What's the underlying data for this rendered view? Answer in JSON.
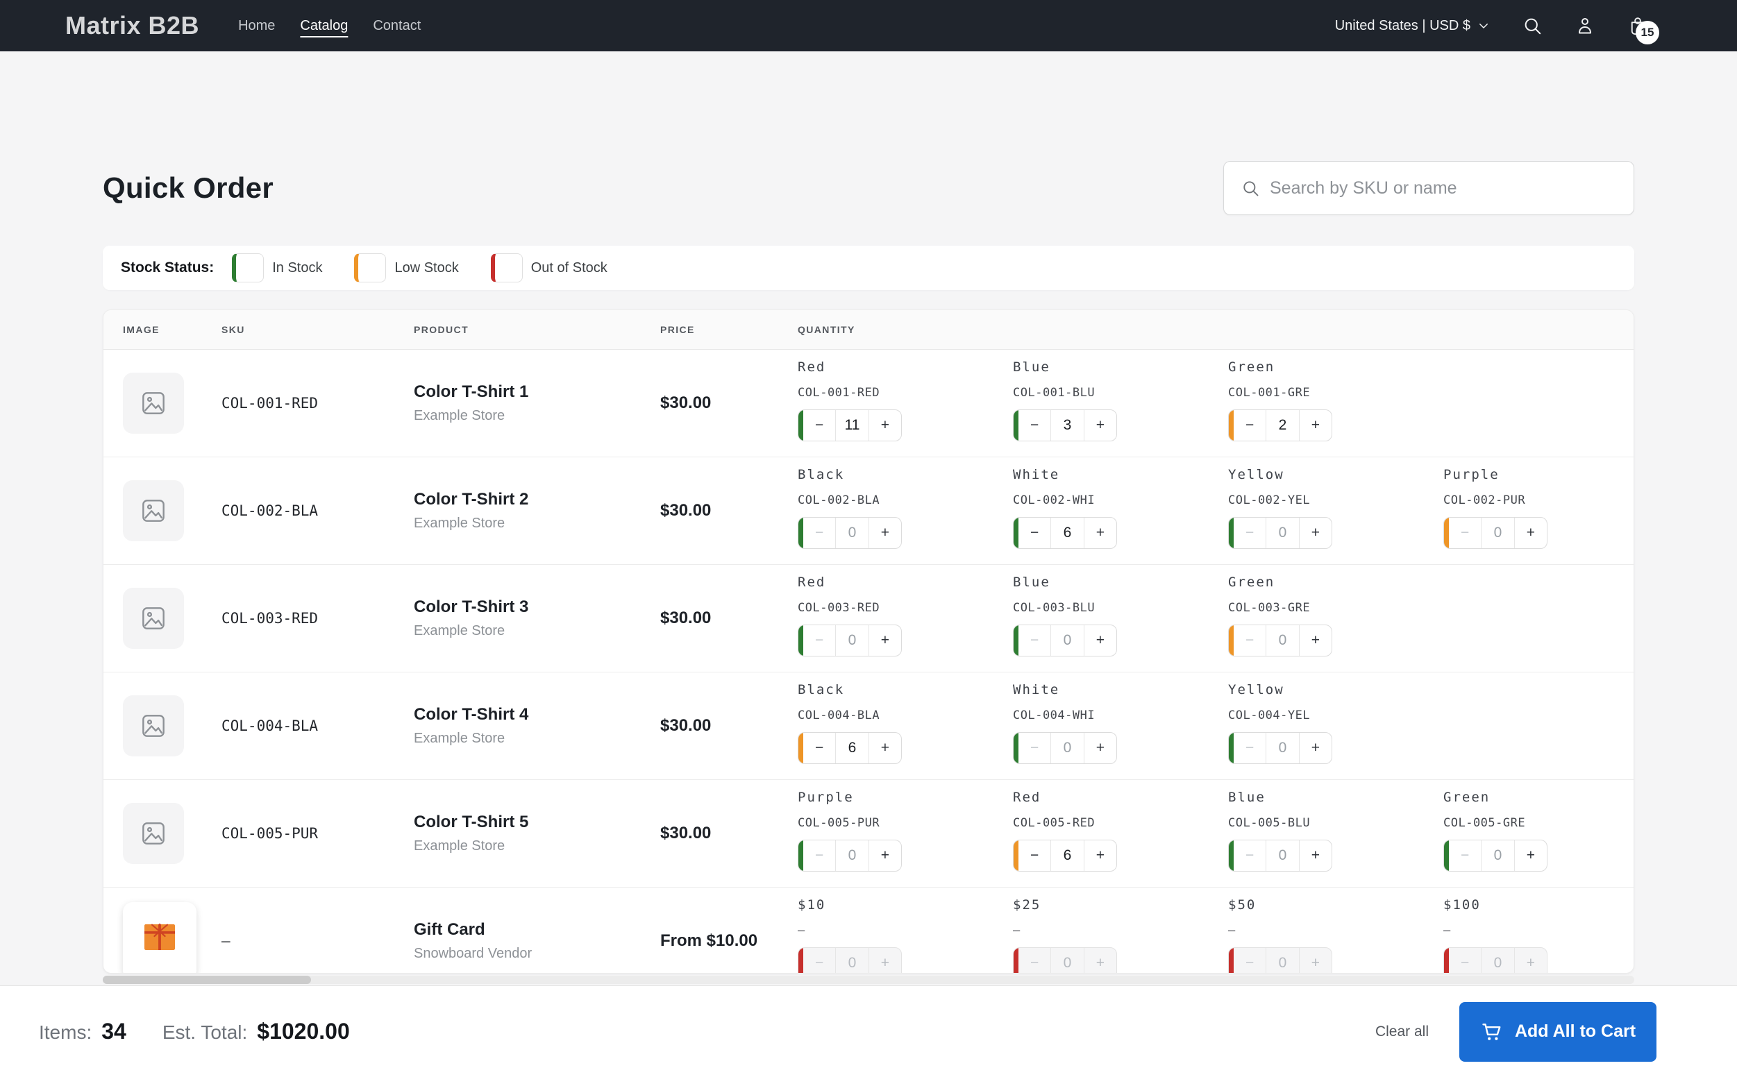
{
  "colors": {
    "status": {
      "in": "#2e7d32",
      "low": "#ee9527",
      "out": "#c62f2c"
    },
    "accent_blue": "#1a6dd4",
    "header_bg": "#1f242c"
  },
  "header": {
    "logo": "Matrix B2B",
    "nav": [
      {
        "label": "Home",
        "active": false
      },
      {
        "label": "Catalog",
        "active": true
      },
      {
        "label": "Contact",
        "active": false
      }
    ],
    "locale": "United States | USD $",
    "cart_count": "15",
    "icons": [
      "chevron-down-icon",
      "search-icon",
      "account-icon",
      "bag-icon"
    ]
  },
  "page": {
    "title": "Quick Order",
    "search": {
      "placeholder": "Search by SKU or name",
      "value": ""
    },
    "legend": {
      "label": "Stock Status:",
      "items": [
        {
          "label": "In Stock",
          "status": "in"
        },
        {
          "label": "Low Stock",
          "status": "low"
        },
        {
          "label": "Out of Stock",
          "status": "out"
        }
      ]
    },
    "stepper_glyphs": {
      "minus": "−",
      "plus": "+"
    }
  },
  "table": {
    "columns": [
      "IMAGE",
      "SKU",
      "PRODUCT",
      "PRICE",
      "QUANTITY"
    ],
    "rows": [
      {
        "image": "image-placeholder",
        "sku": "COL-001-RED",
        "name": "Color T-Shirt 1",
        "vendor": "Example Store",
        "price": "$30.00",
        "variants": [
          {
            "name": "Red",
            "sku": "COL-001-RED",
            "qty": "11",
            "status": "in",
            "disabled": false
          },
          {
            "name": "Blue",
            "sku": "COL-001-BLU",
            "qty": "3",
            "status": "in",
            "disabled": false
          },
          {
            "name": "Green",
            "sku": "COL-001-GRE",
            "qty": "2",
            "status": "low",
            "disabled": false
          }
        ]
      },
      {
        "image": "image-placeholder",
        "sku": "COL-002-BLA",
        "name": "Color T-Shirt 2",
        "vendor": "Example Store",
        "price": "$30.00",
        "variants": [
          {
            "name": "Black",
            "sku": "COL-002-BLA",
            "qty": "0",
            "status": "in",
            "disabled": false
          },
          {
            "name": "White",
            "sku": "COL-002-WHI",
            "qty": "6",
            "status": "in",
            "disabled": false
          },
          {
            "name": "Yellow",
            "sku": "COL-002-YEL",
            "qty": "0",
            "status": "in",
            "disabled": false
          },
          {
            "name": "Purple",
            "sku": "COL-002-PUR",
            "qty": "0",
            "status": "low",
            "disabled": false
          }
        ]
      },
      {
        "image": "image-placeholder",
        "sku": "COL-003-RED",
        "name": "Color T-Shirt 3",
        "vendor": "Example Store",
        "price": "$30.00",
        "variants": [
          {
            "name": "Red",
            "sku": "COL-003-RED",
            "qty": "0",
            "status": "in",
            "disabled": false
          },
          {
            "name": "Blue",
            "sku": "COL-003-BLU",
            "qty": "0",
            "status": "in",
            "disabled": false
          },
          {
            "name": "Green",
            "sku": "COL-003-GRE",
            "qty": "0",
            "status": "low",
            "disabled": false
          }
        ]
      },
      {
        "image": "image-placeholder",
        "sku": "COL-004-BLA",
        "name": "Color T-Shirt 4",
        "vendor": "Example Store",
        "price": "$30.00",
        "variants": [
          {
            "name": "Black",
            "sku": "COL-004-BLA",
            "qty": "6",
            "status": "low",
            "disabled": false
          },
          {
            "name": "White",
            "sku": "COL-004-WHI",
            "qty": "0",
            "status": "in",
            "disabled": false
          },
          {
            "name": "Yellow",
            "sku": "COL-004-YEL",
            "qty": "0",
            "status": "in",
            "disabled": false
          }
        ]
      },
      {
        "image": "image-placeholder",
        "sku": "COL-005-PUR",
        "name": "Color T-Shirt 5",
        "vendor": "Example Store",
        "price": "$30.00",
        "variants": [
          {
            "name": "Purple",
            "sku": "COL-005-PUR",
            "qty": "0",
            "status": "in",
            "disabled": false
          },
          {
            "name": "Red",
            "sku": "COL-005-RED",
            "qty": "6",
            "status": "low",
            "disabled": false
          },
          {
            "name": "Blue",
            "sku": "COL-005-BLU",
            "qty": "0",
            "status": "in",
            "disabled": false
          },
          {
            "name": "Green",
            "sku": "COL-005-GRE",
            "qty": "0",
            "status": "in",
            "disabled": false
          }
        ]
      },
      {
        "image": "gift-card",
        "sku": "–",
        "name": "Gift Card",
        "vendor": "Snowboard Vendor",
        "price": "From $10.00",
        "variants": [
          {
            "name": "$10",
            "sku": "–",
            "qty": "0",
            "status": "out",
            "disabled": true
          },
          {
            "name": "$25",
            "sku": "–",
            "qty": "0",
            "status": "out",
            "disabled": true
          },
          {
            "name": "$50",
            "sku": "–",
            "qty": "0",
            "status": "out",
            "disabled": true
          },
          {
            "name": "$100",
            "sku": "–",
            "qty": "0",
            "status": "out",
            "disabled": true
          }
        ]
      }
    ]
  },
  "footer": {
    "items_label": "Items:",
    "items_value": "34",
    "total_label": "Est. Total:",
    "total_value": "$1020.00",
    "clear_label": "Clear all",
    "add_to_cart_label": "Add All to Cart"
  }
}
